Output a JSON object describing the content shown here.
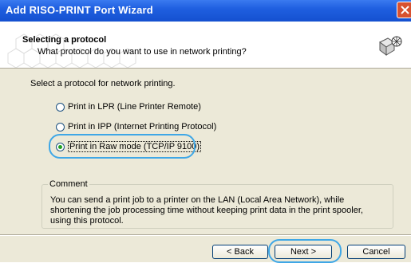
{
  "window": {
    "title": "Add RISO-PRINT Port Wizard"
  },
  "header": {
    "title": "Selecting a protocol",
    "subtitle": "What protocol do you want to use in network printing?"
  },
  "main": {
    "instruction": "Select a protocol for network printing.",
    "options": [
      {
        "label": "Print in LPR (Line Printer Remote)",
        "selected": false
      },
      {
        "label": "Print in IPP (Internet Printing Protocol)",
        "selected": false
      },
      {
        "label": "Print in Raw mode (TCP/IP 9100)",
        "selected": true
      }
    ],
    "comment": {
      "legend": "Comment",
      "text": "You can send a print job to a printer on the LAN (Local Area Network), while shortening the job processing time without keeping print data in the print spooler, using this protocol."
    }
  },
  "footer": {
    "back_label": "< Back",
    "next_label": "Next >",
    "cancel_label": "Cancel"
  },
  "colors": {
    "titlebar": "#1f5fe0",
    "highlight": "#3fa7e6",
    "radio_dot": "#21a121"
  }
}
